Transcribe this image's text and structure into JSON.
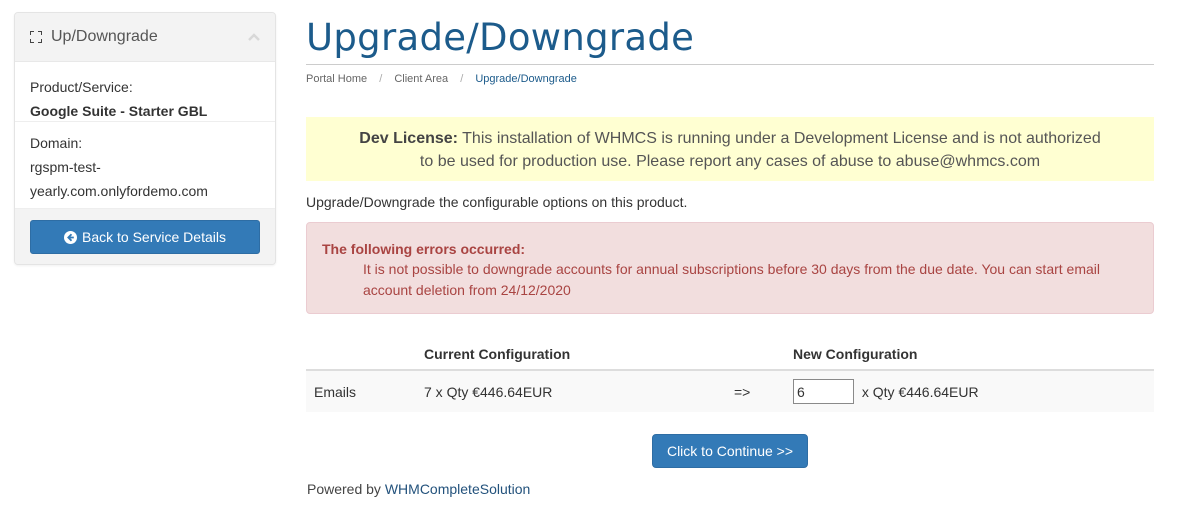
{
  "sidebar": {
    "panel_title": "Up/Downgrade",
    "panel_icon": "expand-icon",
    "collapse_icon": "chevron-up-icon",
    "product_label": "Product/Service:",
    "product_value": "Google Suite - Starter GBL",
    "domain_label": "Domain:",
    "domain_value_line1": "rgspm-test-",
    "domain_value_line2": "yearly.com.onlyfordemo.com",
    "back_button": {
      "label": "Back to Service Details",
      "icon": "arrow-circle-left-icon"
    }
  },
  "header": {
    "title": "Upgrade/Downgrade",
    "breadcrumb": [
      {
        "label": "Portal Home",
        "active": false
      },
      {
        "label": "Client Area",
        "active": false
      },
      {
        "label": "Upgrade/Downgrade",
        "active": true
      }
    ],
    "breadcrumb_separator": "/"
  },
  "dev_license": {
    "label": "Dev License:",
    "message_line1": "This installation of WHMCS is running under a Development License and is not authorized",
    "message_line2": "to be used for production use. Please report any cases of abuse to abuse@whmcs.com"
  },
  "intro": "Upgrade/Downgrade the configurable options on this product.",
  "errors": {
    "title": "The following errors occurred:",
    "items": [
      "It is not possible to downgrade accounts for annual subscriptions before 30 days from the due date. You can start email account deletion from 24/12/2020"
    ]
  },
  "config_table": {
    "headers": [
      "",
      "Current Configuration",
      "",
      "New Configuration"
    ],
    "rows": [
      {
        "name": "Emails",
        "current": "7 x Qty €446.64EUR",
        "arrow": "=>",
        "new_qty": "6",
        "new_suffix": "x Qty €446.64EUR"
      }
    ]
  },
  "continue_button": "Click to Continue >>",
  "footer": {
    "powered_prefix": "Powered by",
    "powered_link": "WHMCompleteSolution"
  },
  "colors": {
    "primary": "#337ab7",
    "title": "#1c5b8b",
    "dev_alert_bg": "#ffffd2",
    "error_bg": "#f2dede",
    "error_text": "#a94442"
  }
}
